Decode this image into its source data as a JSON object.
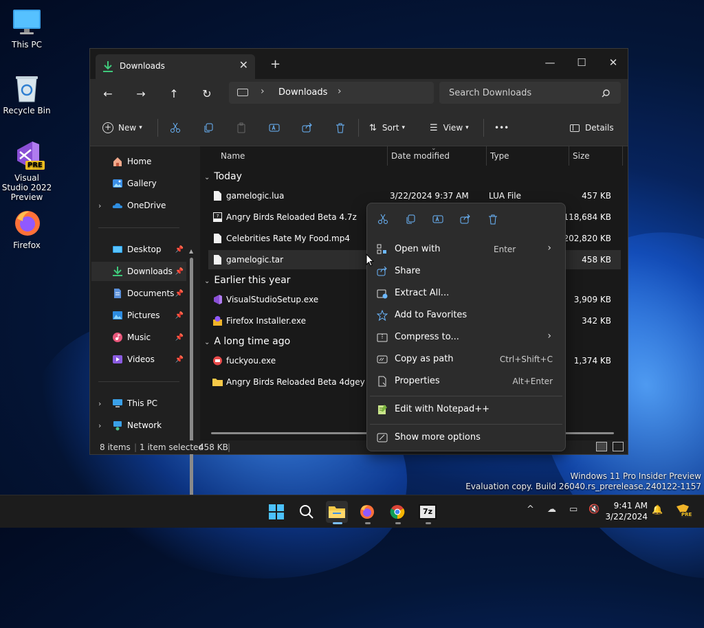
{
  "desktop": {
    "icons": [
      {
        "label": "This PC"
      },
      {
        "label": "Recycle Bin"
      },
      {
        "label": "Visual Studio 2022 Preview",
        "badge": "PRE"
      },
      {
        "label": "Firefox"
      }
    ]
  },
  "window": {
    "tab_label": "Downloads",
    "new_tab": "+",
    "address": {
      "crumb": "Downloads"
    },
    "search": {
      "placeholder": "Search Downloads"
    },
    "toolbar": {
      "new_label": "New",
      "sort_label": "Sort",
      "view_label": "View",
      "more_label": "•••",
      "details_label": "Details"
    },
    "nav": {
      "home": "Home",
      "gallery": "Gallery",
      "onedrive": "OneDrive",
      "desktop": "Desktop",
      "downloads": "Downloads",
      "documents": "Documents",
      "pictures": "Pictures",
      "music": "Music",
      "videos": "Videos",
      "thispc": "This PC",
      "network": "Network"
    },
    "columns": {
      "name": "Name",
      "date": "Date modified",
      "type": "Type",
      "size": "Size"
    },
    "groups": {
      "today": "Today",
      "earlier": "Earlier this year",
      "longago": "A long time ago"
    },
    "files": [
      {
        "name": "gamelogic.lua",
        "date": "3/22/2024 9:37 AM",
        "type": "LUA File",
        "size": "457 KB"
      },
      {
        "name": "Angry Birds Reloaded Beta 4.7z",
        "date": "",
        "type": "",
        "size": "118,684 KB"
      },
      {
        "name": "Celebrities Rate My Food.mp4",
        "date": "",
        "type": "",
        "size": "202,820 KB"
      },
      {
        "name": "gamelogic.tar",
        "date": "",
        "type": "",
        "size": "458 KB"
      },
      {
        "name": "VisualStudioSetup.exe",
        "date": "",
        "type": "",
        "size": "3,909 KB"
      },
      {
        "name": "Firefox Installer.exe",
        "date": "",
        "type": "",
        "size": "342 KB"
      },
      {
        "name": "fuckyou.exe",
        "date": "",
        "type": "",
        "size": "1,374 KB"
      },
      {
        "name": "Angry Birds Reloaded Beta 4dgey",
        "date": "",
        "type": "",
        "size": ""
      }
    ],
    "status": {
      "count": "8 items",
      "selected": "1 item selected",
      "size": "458 KB"
    }
  },
  "context_menu": {
    "items": [
      {
        "label": "Open with",
        "shortcut": "Enter",
        "submenu": true
      },
      {
        "label": "Share"
      },
      {
        "label": "Extract All..."
      },
      {
        "label": "Add to Favorites"
      },
      {
        "label": "Compress to...",
        "submenu": true
      },
      {
        "label": "Copy as path",
        "shortcut": "Ctrl+Shift+C"
      },
      {
        "label": "Properties",
        "shortcut": "Alt+Enter"
      },
      {
        "label": "Edit with Notepad++"
      },
      {
        "label": "Show more options"
      }
    ]
  },
  "watermark": {
    "line1": "Windows 11 Pro Insider Preview",
    "line2": "Evaluation copy. Build 26040.rs_prerelease.240122-1157"
  },
  "taskbar": {
    "seven_zip_label": "7z",
    "time": "9:41 AM",
    "date": "3/22/2024",
    "pre_badge": "PRE"
  },
  "colors": {
    "accent": "#60cdff",
    "folder": "#f7c948",
    "selection": "#2d2d2d"
  }
}
